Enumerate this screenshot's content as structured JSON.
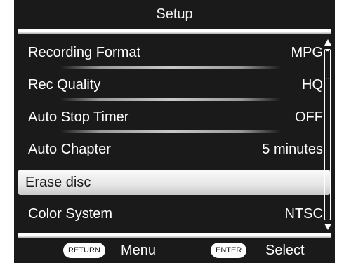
{
  "header": {
    "title": "Setup"
  },
  "menu": {
    "items": [
      {
        "label": "Recording Format",
        "value": "MPG"
      },
      {
        "label": "Rec Quality",
        "value": "HQ"
      },
      {
        "label": "Auto Stop Timer",
        "value": "OFF"
      },
      {
        "label": "Auto Chapter",
        "value": "5 minutes"
      },
      {
        "label": "Erase disc",
        "value": "",
        "selected": true
      },
      {
        "label": "Color System",
        "value": "NTSC"
      }
    ]
  },
  "scrollbar": {
    "position_fraction": 0.0,
    "visible_fraction": 0.17
  },
  "footer": {
    "return_key": "RETURN",
    "return_label": "Menu",
    "enter_key": "ENTER",
    "enter_label": "Select"
  },
  "colors": {
    "background": "#1a1a1a",
    "text": "#ffffff",
    "highlight": "#e6e6e6"
  }
}
